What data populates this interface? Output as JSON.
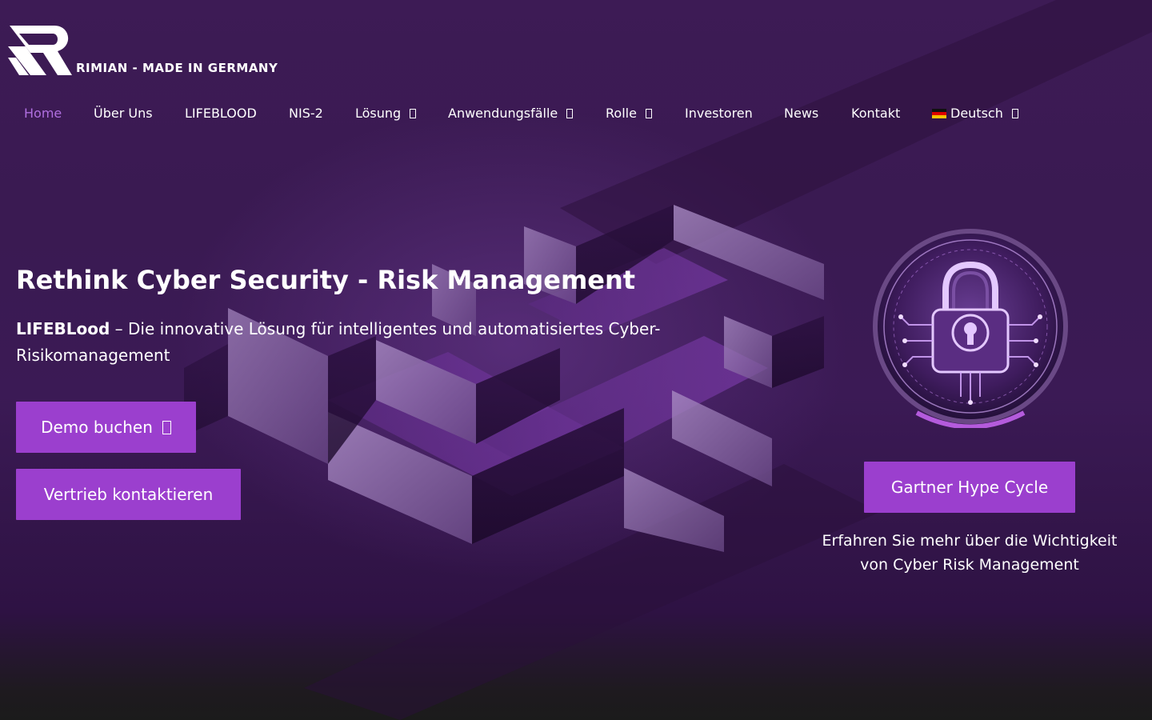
{
  "header": {
    "brand": "RIMIAN - MADE IN GERMANY",
    "logo_icon": "rimian-logo-icon"
  },
  "nav": {
    "items": [
      {
        "label": "Home",
        "active": true
      },
      {
        "label": "Über Uns"
      },
      {
        "label": "LIFEBLOOD"
      },
      {
        "label": "NIS-2"
      },
      {
        "label": "Lösung",
        "dropdown": true
      },
      {
        "label": "Anwendungsfälle",
        "dropdown": true
      },
      {
        "label": "Rolle",
        "dropdown": true
      },
      {
        "label": "Investoren"
      },
      {
        "label": "News"
      },
      {
        "label": "Kontakt"
      },
      {
        "label": "Deutsch",
        "dropdown": true,
        "flag": "german-flag-icon"
      }
    ],
    "active_color": "#b06fe0"
  },
  "hero": {
    "title": "Rethink Cyber Security - Risk Management",
    "lead_bold": "LIFEBLood",
    "lead_rest": " – Die innovative Lösung für intelligentes und automatisiertes Cyber-Risikomanagement",
    "demo_button": "Demo buchen",
    "sales_button": "Vertrieb kontaktieren",
    "button_color": "#9b3fce"
  },
  "aside": {
    "image_icon": "security-lock-icon",
    "gartner_button": "Gartner Hype Cycle",
    "learn_more": "Erfahren Sie mehr über die Wichtigkeit von Cyber Risk Management"
  }
}
